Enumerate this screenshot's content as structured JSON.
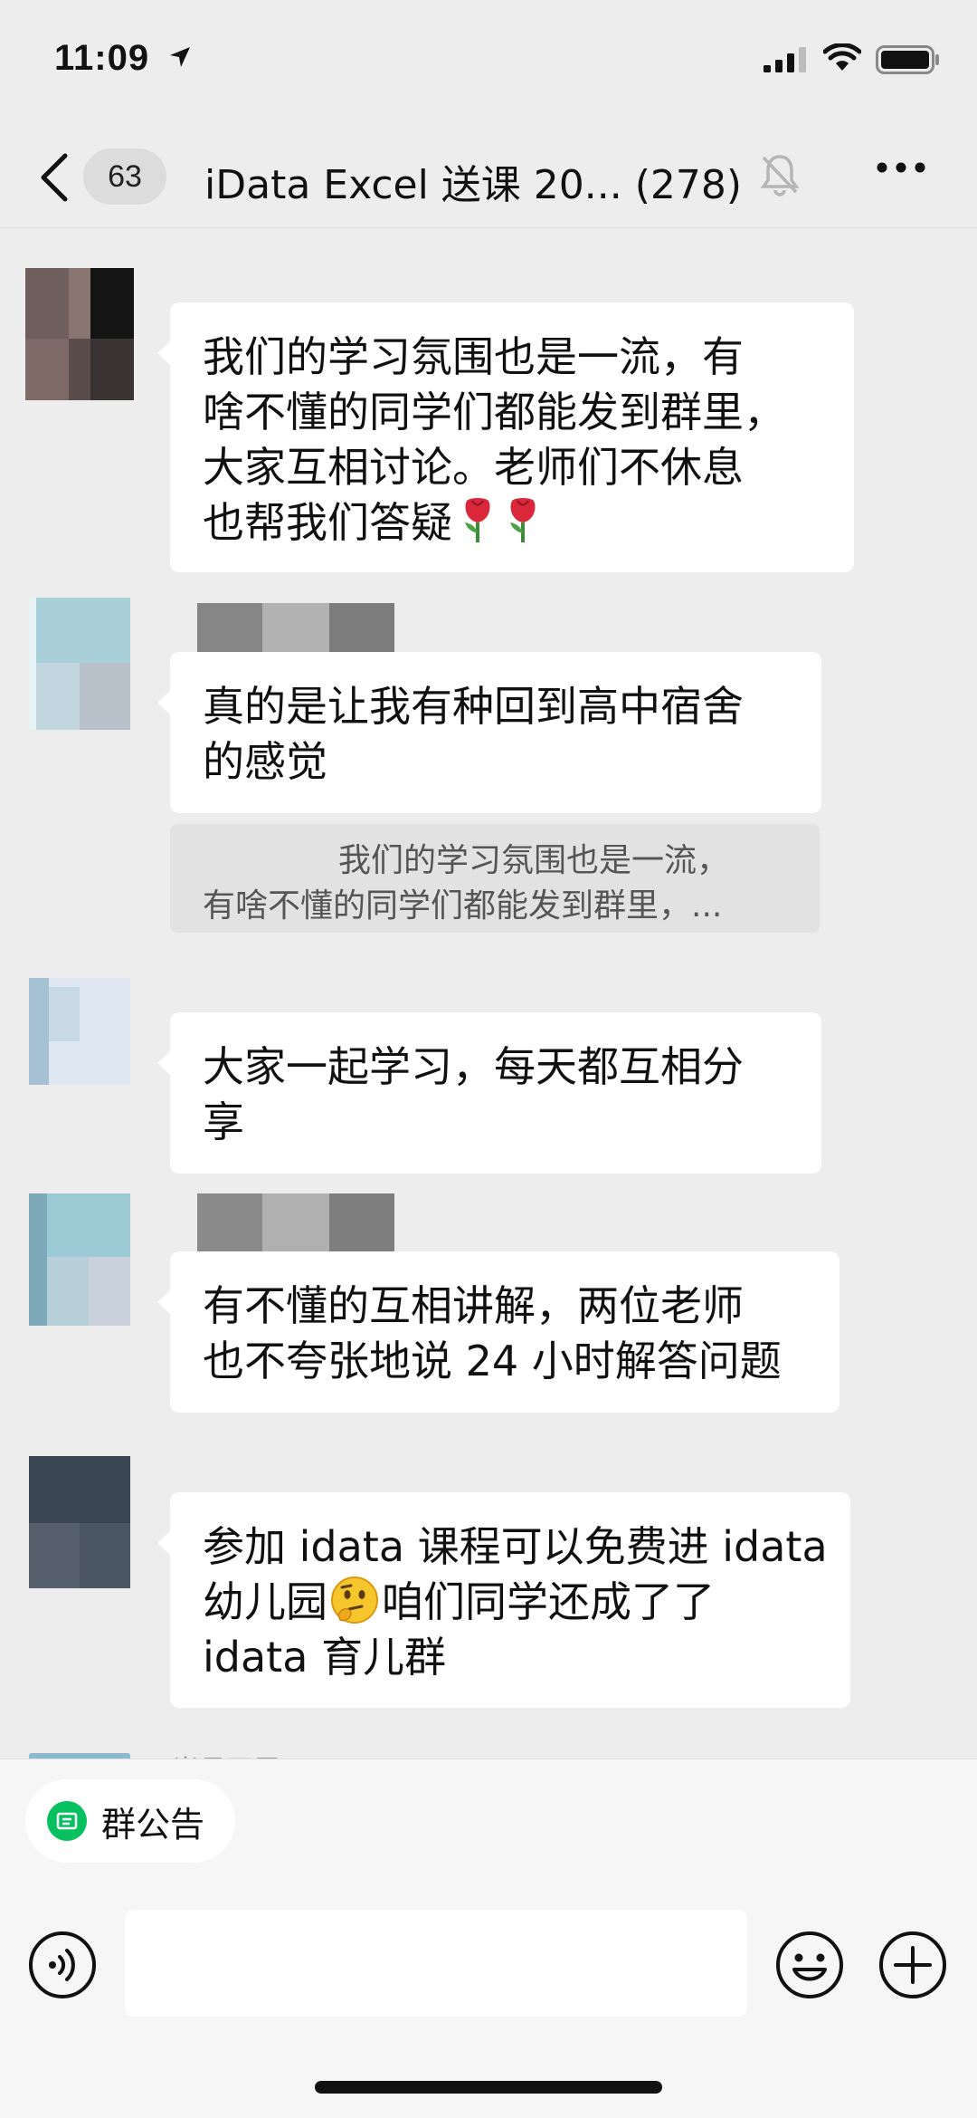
{
  "status_bar": {
    "time": "11:09"
  },
  "nav": {
    "unread_count": "63",
    "title": "iData Excel 送课 20...",
    "member_count": "(278)"
  },
  "messages": [
    {
      "lines": [
        "我们的学习氛围也是一流，有",
        "啥不懂的同学们都能发到群里，",
        "大家互相讨论。老师们不休息",
        "也帮我们答疑"
      ]
    },
    {
      "lines": [
        "真的是让我有种回到高中宿舍",
        "的感觉"
      ],
      "quote_lines": [
        "我们的学习氛围也是一流，",
        "有啥不懂的同学们都能发到群里，..."
      ]
    },
    {
      "lines": [
        "大家一起学习，每天都互相分",
        "享"
      ]
    },
    {
      "lines": [
        "有不懂的互相讲解，两位老师",
        "也不夸张地说 24 小时解答问题"
      ]
    },
    {
      "lines": [
        "参加 idata 课程可以免费进 idata",
        "幼儿园",
        "咱们同学还成了了",
        "idata 育儿群"
      ]
    }
  ],
  "partial_sender_name": "岁月不居",
  "bottom": {
    "notice_label": "群公告"
  },
  "colors": {
    "wechat_green": "#07c160",
    "chat_bg": "#ededed",
    "bubble_bg": "#ffffff"
  }
}
